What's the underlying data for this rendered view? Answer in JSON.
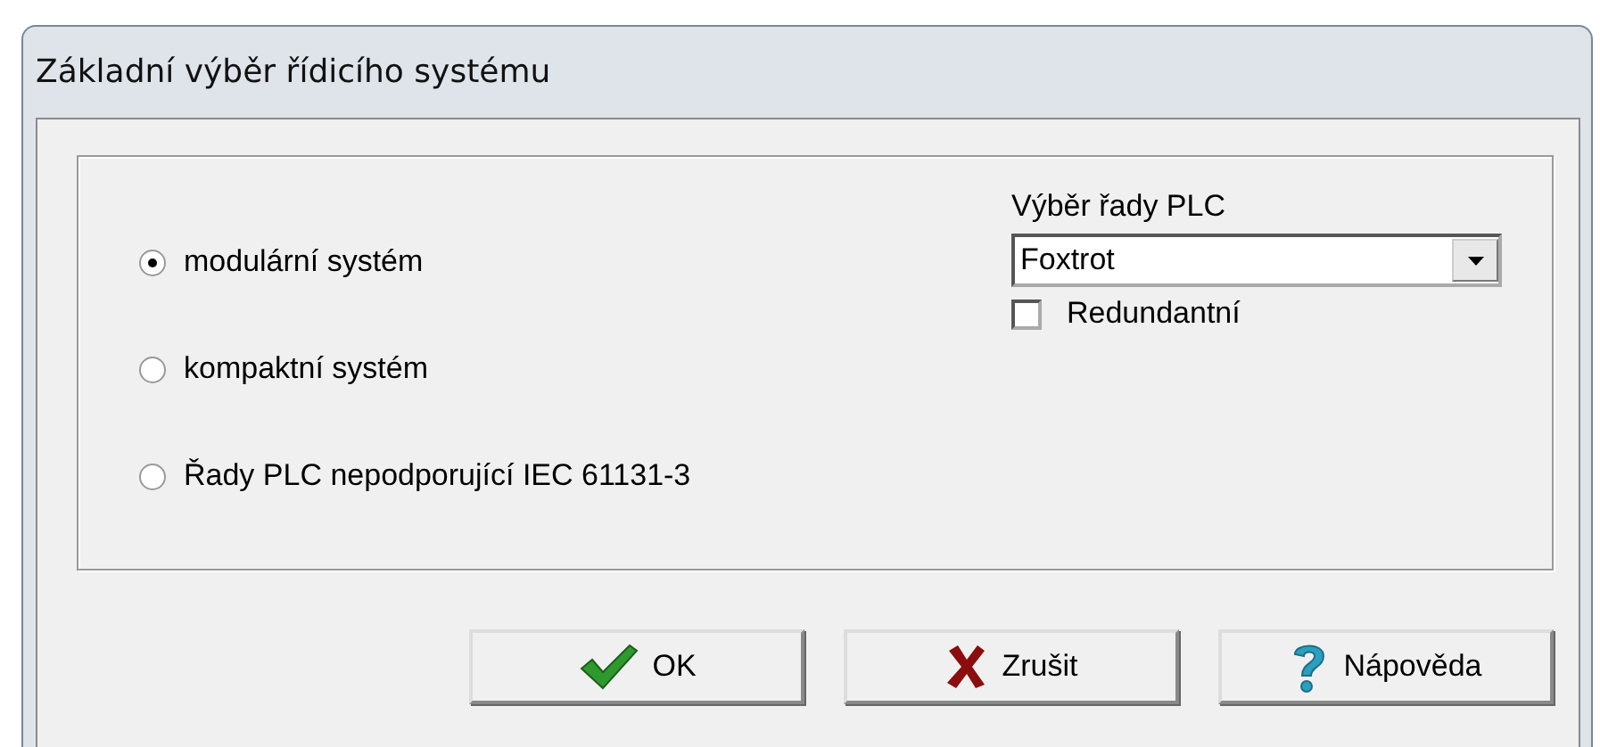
{
  "window": {
    "title": "Základní výběr řídicího systému"
  },
  "radios": [
    {
      "label": "modulární systém",
      "selected": true
    },
    {
      "label": "kompaktní systém",
      "selected": false
    },
    {
      "label": "Řady PLC nepodporující IEC 61131-3",
      "selected": false
    }
  ],
  "plc_series": {
    "label": "Výběr řady PLC",
    "value": "Foxtrot"
  },
  "redundant": {
    "label": "Redundantní",
    "checked": false
  },
  "buttons": [
    {
      "label": "OK",
      "kind": "ok"
    },
    {
      "label": "Zrušit",
      "kind": "cancel"
    },
    {
      "label": "Nápověda",
      "kind": "help"
    }
  ]
}
